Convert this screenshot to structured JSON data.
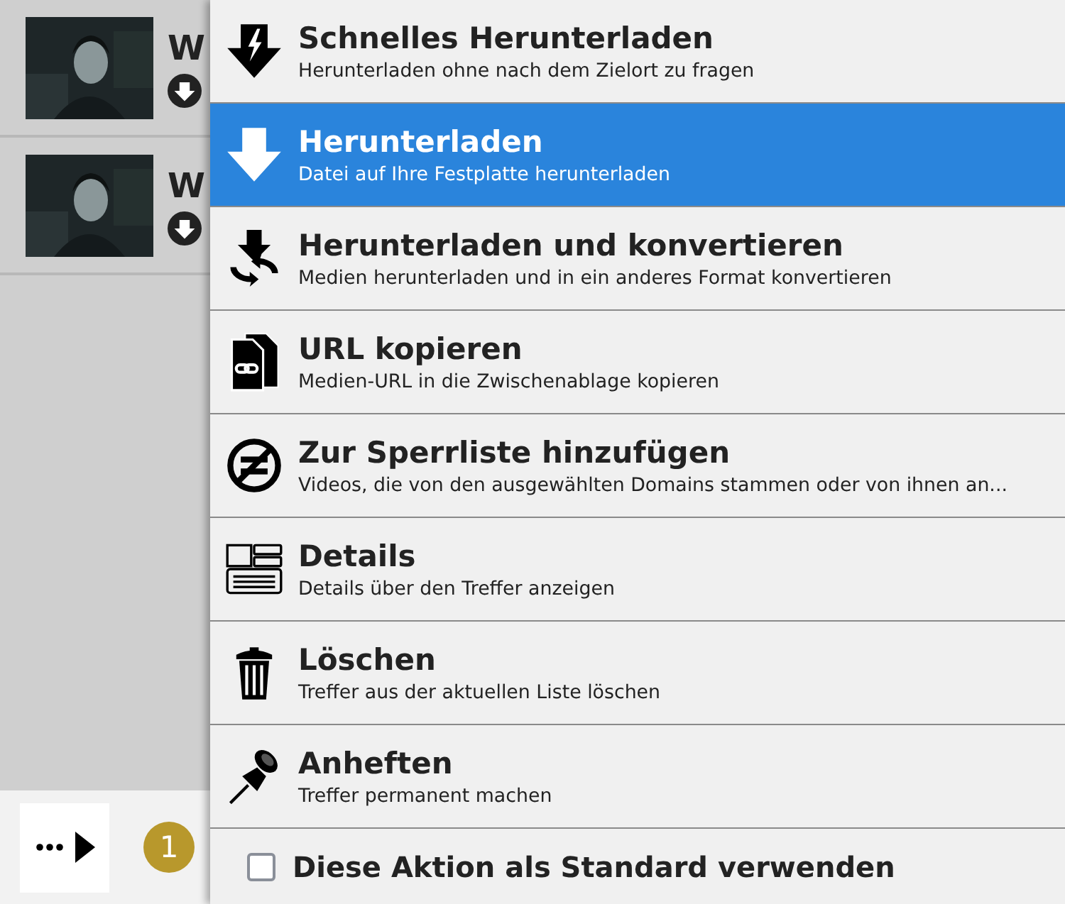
{
  "results": [
    {
      "title": "W"
    },
    {
      "title": "W"
    }
  ],
  "bottom_bar": {
    "badge": "1"
  },
  "menu": {
    "items": [
      {
        "kind": "fast-download",
        "title": "Schnelles Herunterladen",
        "subtitle": "Herunterladen ohne nach dem Zielort zu fragen",
        "selected": false
      },
      {
        "kind": "download",
        "title": "Herunterladen",
        "subtitle": "Datei auf Ihre Festplatte herunterladen",
        "selected": true
      },
      {
        "kind": "convert",
        "title": "Herunterladen und konvertieren",
        "subtitle": "Medien herunterladen und in ein anderes Format konvertieren",
        "selected": false
      },
      {
        "kind": "copy-url",
        "title": "URL kopieren",
        "subtitle": "Medien-URL in die Zwischenablage kopieren",
        "selected": false
      },
      {
        "kind": "blocklist",
        "title": "Zur Sperrliste hinzufügen",
        "subtitle": "Videos, die von den ausgewählten Domains stammen oder von ihnen an...",
        "selected": false
      },
      {
        "kind": "details",
        "title": "Details",
        "subtitle": "Details über den Treffer anzeigen",
        "selected": false
      },
      {
        "kind": "delete",
        "title": "Löschen",
        "subtitle": "Treffer aus der aktuellen Liste löschen",
        "selected": false
      },
      {
        "kind": "pin",
        "title": "Anheften",
        "subtitle": "Treffer permanent machen",
        "selected": false
      }
    ],
    "default_option": {
      "label": "Diese Aktion als Standard verwenden",
      "checked": false
    }
  }
}
